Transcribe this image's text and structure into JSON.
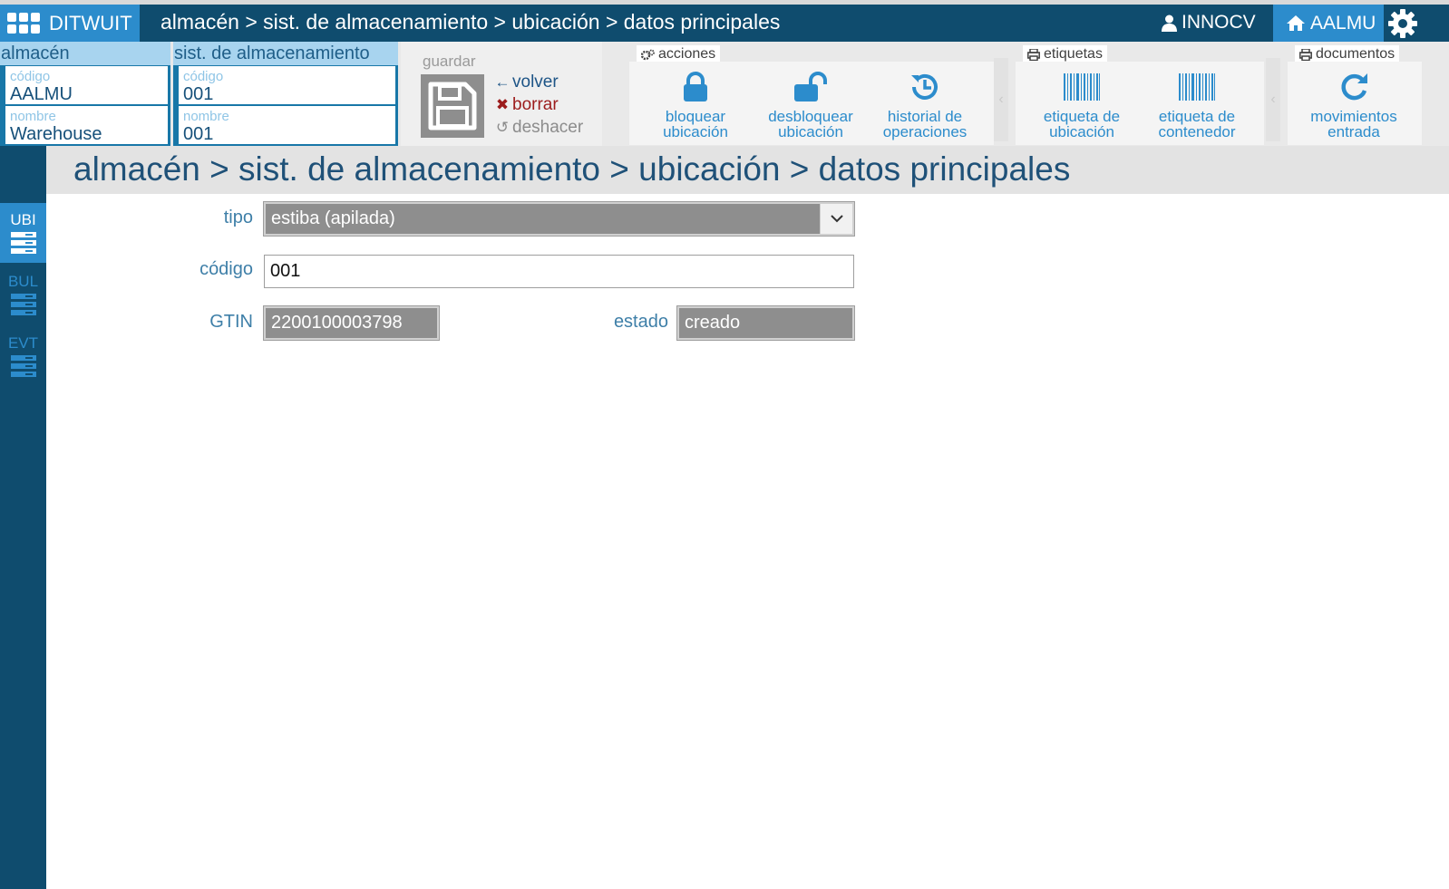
{
  "app": {
    "name": "DITWUIT"
  },
  "topbar": {
    "breadcrumb": "almacén > sist. de almacenamiento > ubicación > datos principales",
    "user": "INNOCV",
    "home": "AALMU"
  },
  "context": {
    "almacen": {
      "title": "almacén",
      "code_label": "código",
      "code": "AALMU",
      "name_label": "nombre",
      "name": "Warehouse"
    },
    "sistema": {
      "title": "sist. de almacenamiento",
      "code_label": "código",
      "code": "001",
      "name_label": "nombre",
      "name": "001"
    }
  },
  "save_group": {
    "label": "guardar",
    "volver": "volver",
    "borrar": "borrar",
    "deshacer": "deshacer"
  },
  "acciones": {
    "tab": "acciones",
    "buttons": [
      {
        "line1": "bloquear",
        "line2": "ubicación",
        "icon": "lock-icon"
      },
      {
        "line1": "desbloquear",
        "line2": "ubicación",
        "icon": "unlock-icon"
      },
      {
        "line1": "historial de",
        "line2": "operaciones",
        "icon": "history-icon"
      }
    ]
  },
  "etiquetas": {
    "tab": "etiquetas",
    "buttons": [
      {
        "line1": "etiqueta de",
        "line2": "ubicación",
        "icon": "barcode-icon"
      },
      {
        "line1": "etiqueta de",
        "line2": "contenedor",
        "icon": "barcode-icon"
      }
    ]
  },
  "documentos": {
    "tab": "documentos",
    "buttons": [
      {
        "line1": "movimientos",
        "line2": "entrada",
        "icon": "refresh-icon"
      }
    ]
  },
  "rail": [
    {
      "label": "UBI",
      "active": true
    },
    {
      "label": "BUL",
      "active": false
    },
    {
      "label": "EVT",
      "active": false
    }
  ],
  "page": {
    "title": "almacén > sist. de almacenamiento > ubicación > datos principales"
  },
  "form": {
    "tipo": {
      "label": "tipo",
      "value": "estiba (apilada)"
    },
    "codigo": {
      "label": "código",
      "value": "001"
    },
    "gtin": {
      "label": "GTIN",
      "value": "2200100003798"
    },
    "estado": {
      "label": "estado",
      "value": "creado"
    }
  },
  "colors": {
    "navy": "#0f4c6e",
    "accent": "#2c8ccc",
    "light_accent": "#a8d4ef",
    "danger": "#9c1c1c",
    "field_grey": "#8e8e8e"
  }
}
